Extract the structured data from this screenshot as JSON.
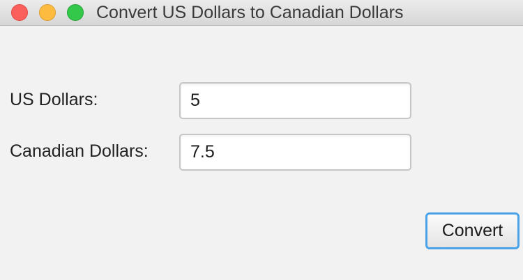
{
  "window": {
    "title": "Convert US Dollars to Canadian Dollars"
  },
  "form": {
    "us_label": "US Dollars:",
    "us_value": "5",
    "cad_label": "Canadian Dollars:",
    "cad_value": "7.5"
  },
  "actions": {
    "convert_label": "Convert"
  },
  "colors": {
    "close": "#fc605c",
    "minimize": "#fdbc40",
    "zoom": "#34c84a",
    "focus_ring": "#4aa3e8",
    "background": "#f2f2f2"
  }
}
